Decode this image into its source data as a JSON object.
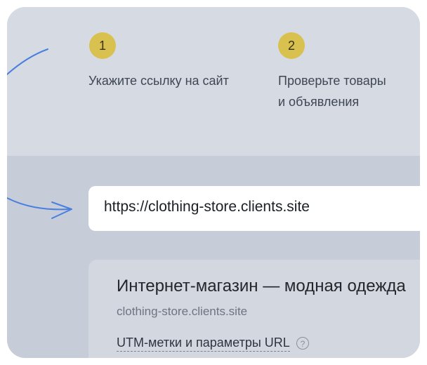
{
  "steps": [
    {
      "number": "1",
      "line1": "Укажите ссылку на сайт",
      "line2": ""
    },
    {
      "number": "2",
      "line1": "Проверьте товары",
      "line2": "и объявления"
    }
  ],
  "url_input": {
    "value": "https://clothing-store.clients.site"
  },
  "site_card": {
    "title": "Интернет-магазин — модная одежда",
    "domain": "clothing-store.clients.site",
    "utm_label": "UTM-метки и параметры URL",
    "help_symbol": "?"
  },
  "colors": {
    "badge": "#d9c14f",
    "arrow": "#4a7fe0",
    "panel_top": "#d6dae2",
    "panel_bottom": "#c7cdd8"
  }
}
